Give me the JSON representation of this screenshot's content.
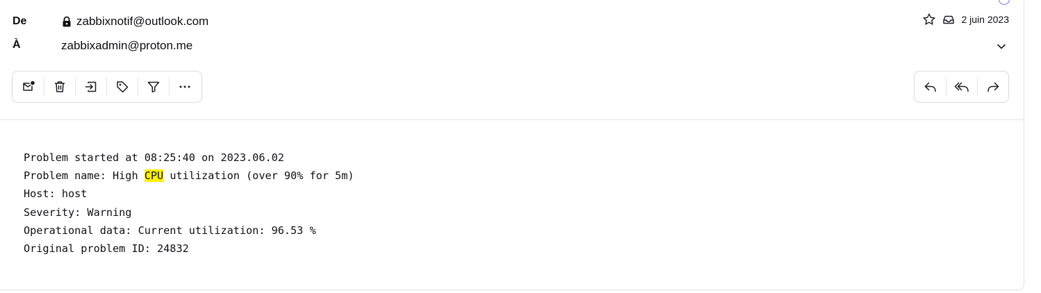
{
  "header": {
    "from_label": "De",
    "from_value": "zabbixnotif@outlook.com",
    "to_label": "À",
    "to_value": "zabbixadmin@proton.me",
    "date": "2 juin 2023"
  },
  "icons": {
    "lock": "lock-icon",
    "star": "star-icon",
    "inbox": "inbox-icon",
    "chevron": "chevron-down-icon"
  },
  "toolbar_left": [
    "mark-unread",
    "trash",
    "move-to",
    "label",
    "filter",
    "more"
  ],
  "toolbar_right": [
    "reply",
    "reply-all",
    "forward"
  ],
  "message": {
    "line1": "Problem started at 08:25:40 on 2023.06.02",
    "line2_pre": "Problem name: High ",
    "line2_highlight": "CPU",
    "line2_post": " utilization (over 90% for 5m)",
    "line3": "Host: host",
    "line4": "Severity: Warning",
    "line5": "Operational data: Current utilization: 96.53 %",
    "line6": "Original problem ID: 24832"
  },
  "colors": {
    "highlight": "#fff200",
    "accent": "#8a6ef3"
  }
}
